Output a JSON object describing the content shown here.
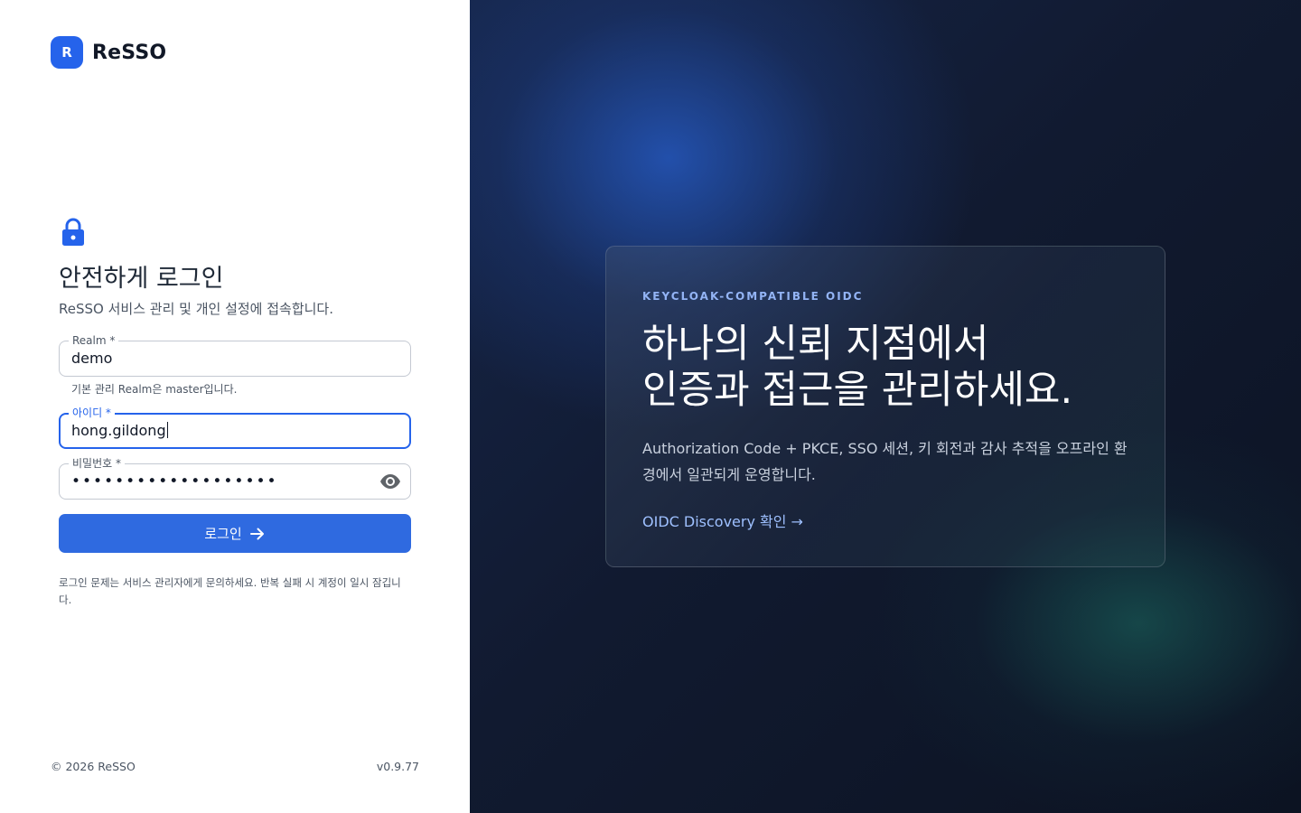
{
  "brand": {
    "badge": "R",
    "name": "ReSSO"
  },
  "login": {
    "icon": "lock-icon",
    "title": "안전하게 로그인",
    "subtitle": "ReSSO 서비스 관리 및 개인 설정에 접속합니다.",
    "realm": {
      "label": "Realm *",
      "value": "demo",
      "hint": "기본 관리 Realm은 master입니다."
    },
    "username": {
      "label": "아이디 *",
      "value": "hong.gildong"
    },
    "password": {
      "label": "비밀번호 *",
      "value": "•••••••••••••••••••",
      "toggle_icon": "eye-icon"
    },
    "submit_label": "로그인",
    "help": "로그인 문제는 서비스 관리자에게 문의하세요. 반복 실패 시 계정이 일시 잠깁니다."
  },
  "footer": {
    "copyright": "© 2026 ReSSO",
    "version": "v0.9.77"
  },
  "hero": {
    "eyebrow": "KEYCLOAK-COMPATIBLE OIDC",
    "headline_line1": "하나의 신뢰 지점에서",
    "headline_line2": "인증과 접근을 관리하세요.",
    "description": "Authorization Code + PKCE, SSO 세션, 키 회전과 감사 추적을 오프라인 환경에서 일관되게 운영합니다.",
    "link": "OIDC Discovery 확인 →"
  },
  "colors": {
    "accent": "#2563eb",
    "panel_dark": "#111a30",
    "link": "#9ec0ff"
  }
}
